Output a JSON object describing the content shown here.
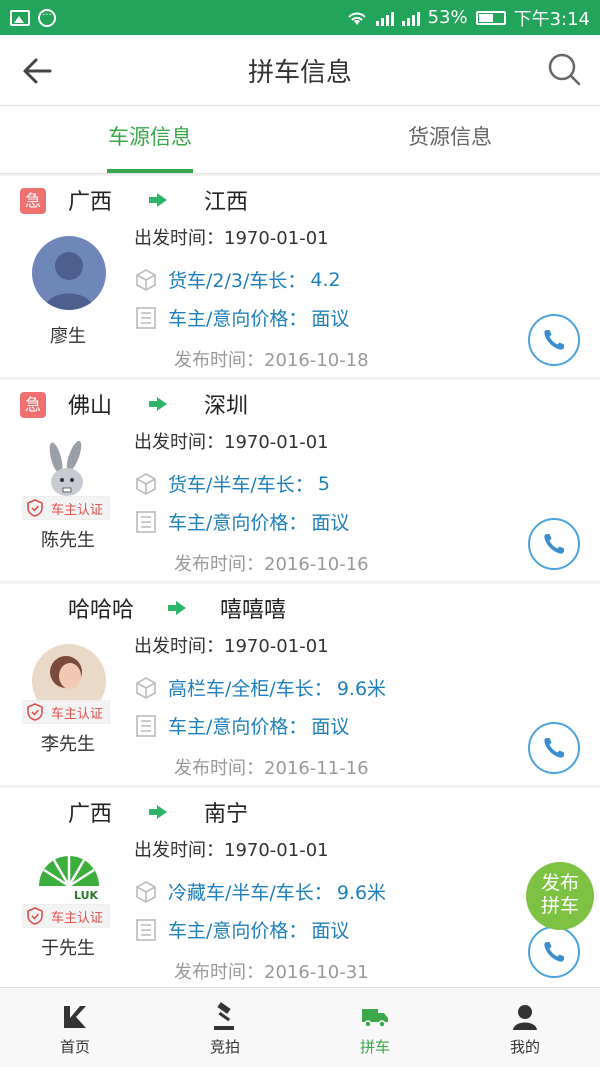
{
  "status_bar": {
    "battery": "53%",
    "time": "下午3:14"
  },
  "header": {
    "title": "拼车信息"
  },
  "tabs": [
    {
      "label": "车源信息",
      "active": true
    },
    {
      "label": "货源信息",
      "active": false
    }
  ],
  "cards": [
    {
      "urgent": "急",
      "from": "广西",
      "to": "江西",
      "depart": "出发时间：1970-01-01",
      "vehicle": "货车/2/3/车长：",
      "length": "4.2",
      "price_label": "车主/意向价格：",
      "price": "面议",
      "publish": "发布时间：2016-10-18",
      "owner": "廖生",
      "certified": false
    },
    {
      "urgent": "急",
      "from": "佛山",
      "to": "深圳",
      "depart": "出发时间：1970-01-01",
      "vehicle": "货车/半车/车长：",
      "length": "5",
      "price_label": "车主/意向价格：",
      "price": "面议",
      "publish": "发布时间：2016-10-16",
      "owner": "陈先生",
      "certified": true,
      "cert_label": "车主认证"
    },
    {
      "urgent": "",
      "from": "哈哈哈",
      "to": "嘻嘻嘻",
      "depart": "出发时间：1970-01-01",
      "vehicle": "高栏车/全柜/车长：",
      "length": "9.6米",
      "price_label": "车主/意向价格：",
      "price": "面议",
      "publish": "发布时间：2016-11-16",
      "owner": "李先生",
      "certified": true,
      "cert_label": "车主认证"
    },
    {
      "urgent": "",
      "from": "广西",
      "to": "南宁",
      "depart": "出发时间：1970-01-01",
      "vehicle": "冷藏车/半车/车长：",
      "length": "9.6米",
      "price_label": "车主/意向价格：",
      "price": "面议",
      "publish": "发布时间：2016-10-31",
      "owner": "于先生",
      "certified": true,
      "cert_label": "车主认证",
      "avatar_logo_text": "LUK"
    }
  ],
  "fab": {
    "line1": "发布",
    "line2": "拼车"
  },
  "bottom_nav": [
    {
      "label": "首页",
      "icon": "home-icon",
      "active": false
    },
    {
      "label": "竞拍",
      "icon": "auction-icon",
      "active": false
    },
    {
      "label": "拼车",
      "icon": "truck-icon",
      "active": true
    },
    {
      "label": "我的",
      "icon": "user-icon",
      "active": false
    }
  ],
  "colors": {
    "status_bar": "#22a45a",
    "accent": "#3aa84a",
    "link": "#1e7fbd",
    "urgent": "#f07070",
    "fab": "#7dc242"
  }
}
